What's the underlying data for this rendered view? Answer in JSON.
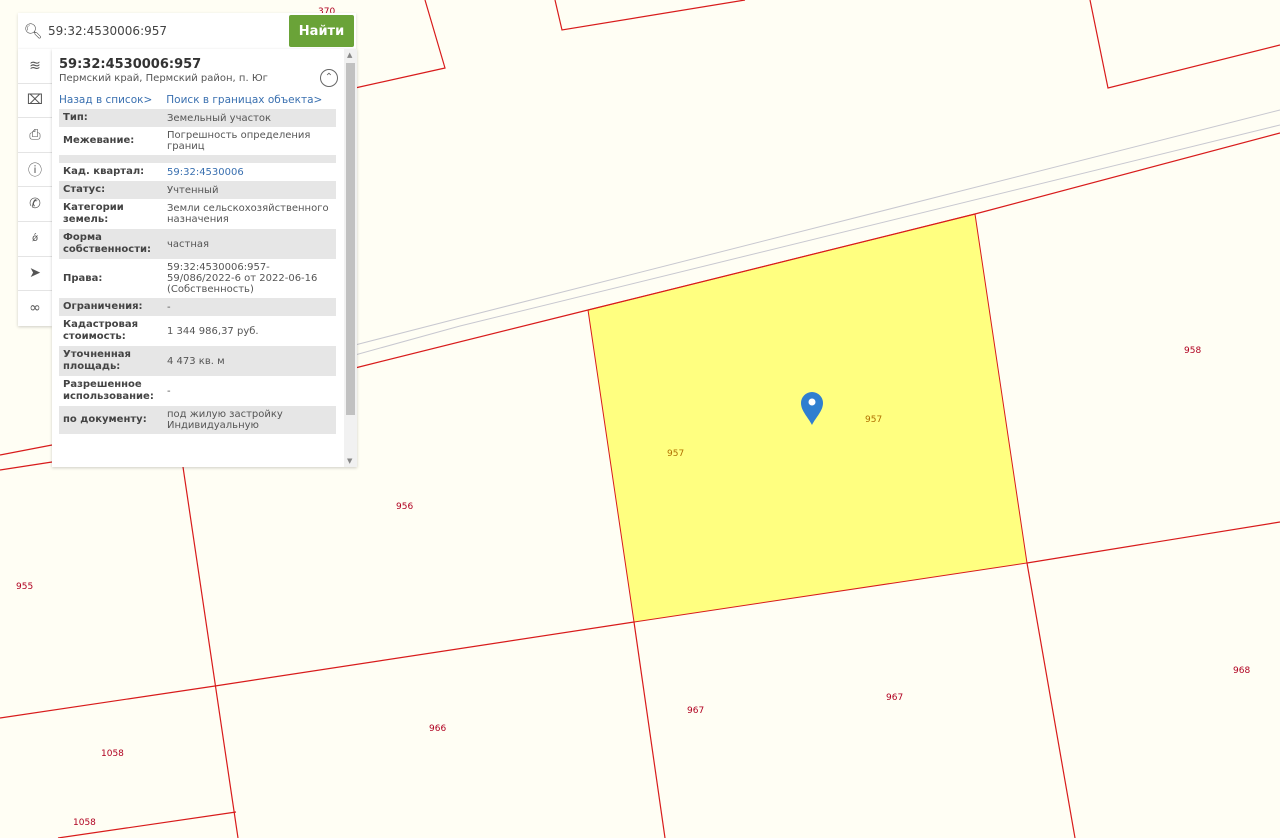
{
  "search": {
    "value": "59:32:4530006:957",
    "button": "Найти"
  },
  "tools": [
    "layers-icon",
    "ruler-icon",
    "print-icon",
    "help-icon",
    "phone-icon",
    "signature-icon",
    "navigate-icon",
    "link-icon"
  ],
  "panel": {
    "title": "59:32:4530006:957",
    "address": "Пермский край, Пермский район, п. Юг",
    "back_link": "Назад в список>",
    "search_link": "Поиск в границах объекта>",
    "rows": [
      {
        "k": "Тип:",
        "v": "Земельный участок"
      },
      {
        "k": "Межевание:",
        "v": "Погрешность определения границ"
      },
      {
        "k": "",
        "v": ""
      },
      {
        "k": "Кад. квартал:",
        "v": "59:32:4530006"
      },
      {
        "k": "Статус:",
        "v": "Учтенный"
      },
      {
        "k": "Категории земель:",
        "v": "Земли сельскохозяйственного назначения"
      },
      {
        "k": "Форма собственности:",
        "v": "частная"
      },
      {
        "k": "Права:",
        "v": "59:32:4530006:957-59/086/2022-6 от 2022-06-16 (Собственность)"
      },
      {
        "k": "Ограничения:",
        "v": "-"
      },
      {
        "k": "Кадастровая стоимость:",
        "v": "1 344 986,37 руб."
      },
      {
        "k": "Уточненная площадь:",
        "v": "4 473 кв. м"
      },
      {
        "k": "Разрешенное использование:",
        "v": "-"
      },
      {
        "k": "по документу:",
        "v": "под жилую застройку Индивидуальную"
      }
    ]
  },
  "map": {
    "parcel_color": "#ffff80",
    "border_color": "#d81b1b",
    "labels": [
      "370",
      "958",
      "957",
      "957",
      "956",
      "955",
      "968",
      "967",
      "967",
      "966",
      "1058",
      "1058"
    ]
  }
}
